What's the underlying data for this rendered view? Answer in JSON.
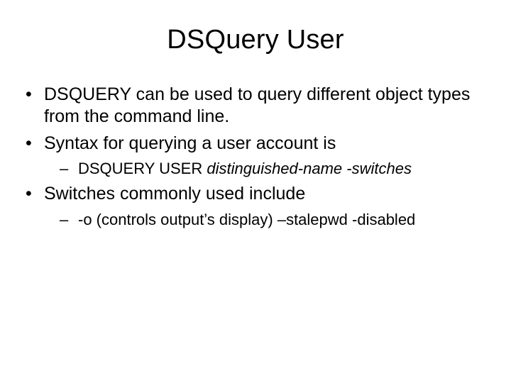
{
  "title": "DSQuery User",
  "bullets": [
    {
      "text": "DSQUERY can be used to query different object types from the command line."
    },
    {
      "text": "Syntax for querying a user account is",
      "sub": [
        {
          "prefix": "DSQUERY USER ",
          "italic": "distinguished-name -switches"
        }
      ]
    },
    {
      "text": "Switches commonly used include",
      "sub": [
        {
          "text": "-o (controls output’s display) –stalepwd -disabled"
        }
      ]
    }
  ]
}
